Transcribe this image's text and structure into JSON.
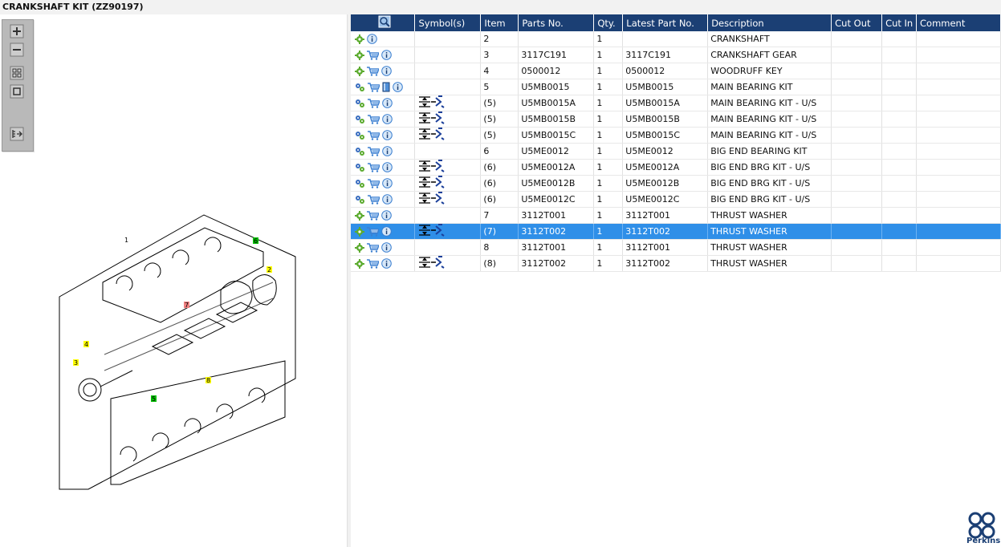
{
  "title": "CRANKSHAFT KIT (ZZ90197)",
  "columns": [
    "",
    "Symbol(s)",
    "Item",
    "Parts No.",
    "Qty.",
    "Latest Part No.",
    "Description",
    "Cut Out",
    "Cut In",
    "Comment"
  ],
  "rows": [
    {
      "icons": [
        "gear",
        "info"
      ],
      "sym": false,
      "item": "2",
      "part": "",
      "qty": "1",
      "latest": "",
      "desc": "CRANKSHAFT",
      "selected": false
    },
    {
      "icons": [
        "gear",
        "cart",
        "info"
      ],
      "sym": false,
      "item": "3",
      "part": "3117C191",
      "qty": "1",
      "latest": "3117C191",
      "desc": "CRANKSHAFT GEAR",
      "selected": false
    },
    {
      "icons": [
        "gear",
        "cart",
        "info"
      ],
      "sym": false,
      "item": "4",
      "part": "0500012",
      "qty": "1",
      "latest": "0500012",
      "desc": "WOODRUFF KEY",
      "selected": false
    },
    {
      "icons": [
        "gears",
        "cart",
        "book",
        "info"
      ],
      "sym": false,
      "item": "5",
      "part": "U5MB0015",
      "qty": "1",
      "latest": "U5MB0015",
      "desc": "MAIN BEARING KIT",
      "selected": false
    },
    {
      "icons": [
        "gears",
        "cart",
        "info"
      ],
      "sym": true,
      "item": "(5)",
      "part": "U5MB0015A",
      "qty": "1",
      "latest": "U5MB0015A",
      "desc": "MAIN BEARING KIT - U/S",
      "selected": false
    },
    {
      "icons": [
        "gears",
        "cart",
        "info"
      ],
      "sym": true,
      "item": "(5)",
      "part": "U5MB0015B",
      "qty": "1",
      "latest": "U5MB0015B",
      "desc": "MAIN BEARING KIT - U/S",
      "selected": false
    },
    {
      "icons": [
        "gears",
        "cart",
        "info"
      ],
      "sym": true,
      "item": "(5)",
      "part": "U5MB0015C",
      "qty": "1",
      "latest": "U5MB0015C",
      "desc": "MAIN BEARING KIT - U/S",
      "selected": false
    },
    {
      "icons": [
        "gears",
        "cart",
        "info"
      ],
      "sym": false,
      "item": "6",
      "part": "U5ME0012",
      "qty": "1",
      "latest": "U5ME0012",
      "desc": "BIG END BEARING KIT",
      "selected": false
    },
    {
      "icons": [
        "gears",
        "cart",
        "info"
      ],
      "sym": true,
      "item": "(6)",
      "part": "U5ME0012A",
      "qty": "1",
      "latest": "U5ME0012A",
      "desc": "BIG END BRG KIT - U/S",
      "selected": false
    },
    {
      "icons": [
        "gears",
        "cart",
        "info"
      ],
      "sym": true,
      "item": "(6)",
      "part": "U5ME0012B",
      "qty": "1",
      "latest": "U5ME0012B",
      "desc": "BIG END BRG KIT - U/S",
      "selected": false
    },
    {
      "icons": [
        "gears",
        "cart",
        "info"
      ],
      "sym": true,
      "item": "(6)",
      "part": "U5ME0012C",
      "qty": "1",
      "latest": "U5ME0012C",
      "desc": "BIG END BRG KIT - U/S",
      "selected": false
    },
    {
      "icons": [
        "gear",
        "cart",
        "info"
      ],
      "sym": false,
      "item": "7",
      "part": "3112T001",
      "qty": "1",
      "latest": "3112T001",
      "desc": "THRUST WASHER",
      "selected": false
    },
    {
      "icons": [
        "gear",
        "cart",
        "info"
      ],
      "sym": true,
      "item": "(7)",
      "part": "3112T002",
      "qty": "1",
      "latest": "3112T002",
      "desc": "THRUST WASHER",
      "selected": true
    },
    {
      "icons": [
        "gear",
        "cart",
        "info"
      ],
      "sym": false,
      "item": "8",
      "part": "3112T001",
      "qty": "1",
      "latest": "3112T001",
      "desc": "THRUST WASHER",
      "selected": false
    },
    {
      "icons": [
        "gear",
        "cart",
        "info"
      ],
      "sym": true,
      "item": "(8)",
      "part": "3112T002",
      "qty": "1",
      "latest": "3112T002",
      "desc": "THRUST WASHER",
      "selected": false
    }
  ],
  "drawing_labels": [
    "1",
    "2",
    "3",
    "4",
    "5",
    "6",
    "7",
    "8"
  ],
  "brand": "Perkins",
  "colors": {
    "header": "#1b3f74",
    "selected": "#2f8fe8",
    "gear": "#5cab2f",
    "info": "#3b7fd0"
  }
}
